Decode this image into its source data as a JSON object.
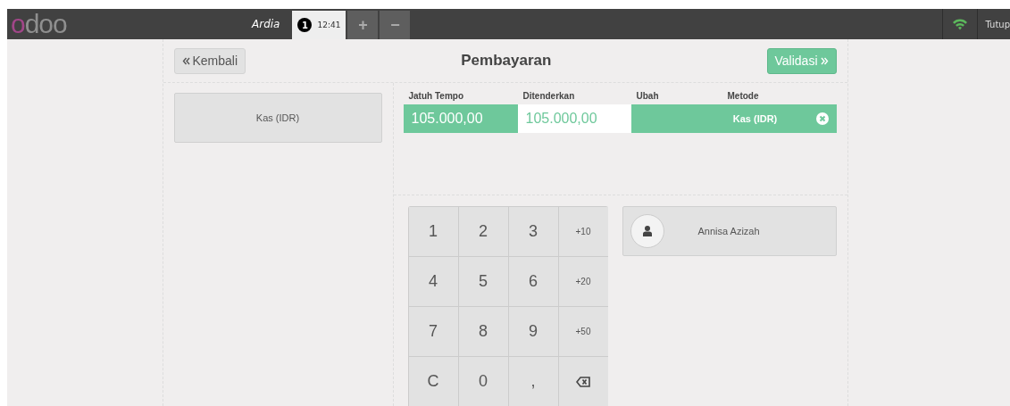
{
  "header": {
    "logo": "odoo",
    "cashier": "Ardia",
    "orders": [
      {
        "number": "1",
        "time": "12:41",
        "selected": true
      }
    ],
    "add_label": "+",
    "remove_label": "−",
    "close_label": "Tutup"
  },
  "screen": {
    "back_label": "Kembali",
    "title": "Pembayaran",
    "validate_label": "Validasi"
  },
  "payment_methods": [
    {
      "label": "Kas (IDR)"
    }
  ],
  "lines_table": {
    "columns": [
      "Jatuh Tempo",
      "Ditenderkan",
      "Ubah",
      "Metode"
    ],
    "rows": [
      {
        "due": "105.000,00",
        "tendered": "105.000,00",
        "method": "Kas (IDR)",
        "selected": true
      }
    ]
  },
  "numpad": [
    {
      "kind": "digit",
      "label": "1"
    },
    {
      "kind": "digit",
      "label": "2"
    },
    {
      "kind": "digit",
      "label": "3"
    },
    {
      "kind": "add",
      "label": "+10"
    },
    {
      "kind": "digit",
      "label": "4"
    },
    {
      "kind": "digit",
      "label": "5"
    },
    {
      "kind": "digit",
      "label": "6"
    },
    {
      "kind": "add",
      "label": "+20"
    },
    {
      "kind": "digit",
      "label": "7"
    },
    {
      "kind": "digit",
      "label": "8"
    },
    {
      "kind": "digit",
      "label": "9"
    },
    {
      "kind": "add",
      "label": "+50"
    },
    {
      "kind": "digit",
      "label": "C"
    },
    {
      "kind": "digit",
      "label": "0"
    },
    {
      "kind": "digit",
      "label": ","
    },
    {
      "kind": "backspace"
    }
  ],
  "customer": {
    "name": "Annisa Azizah"
  }
}
